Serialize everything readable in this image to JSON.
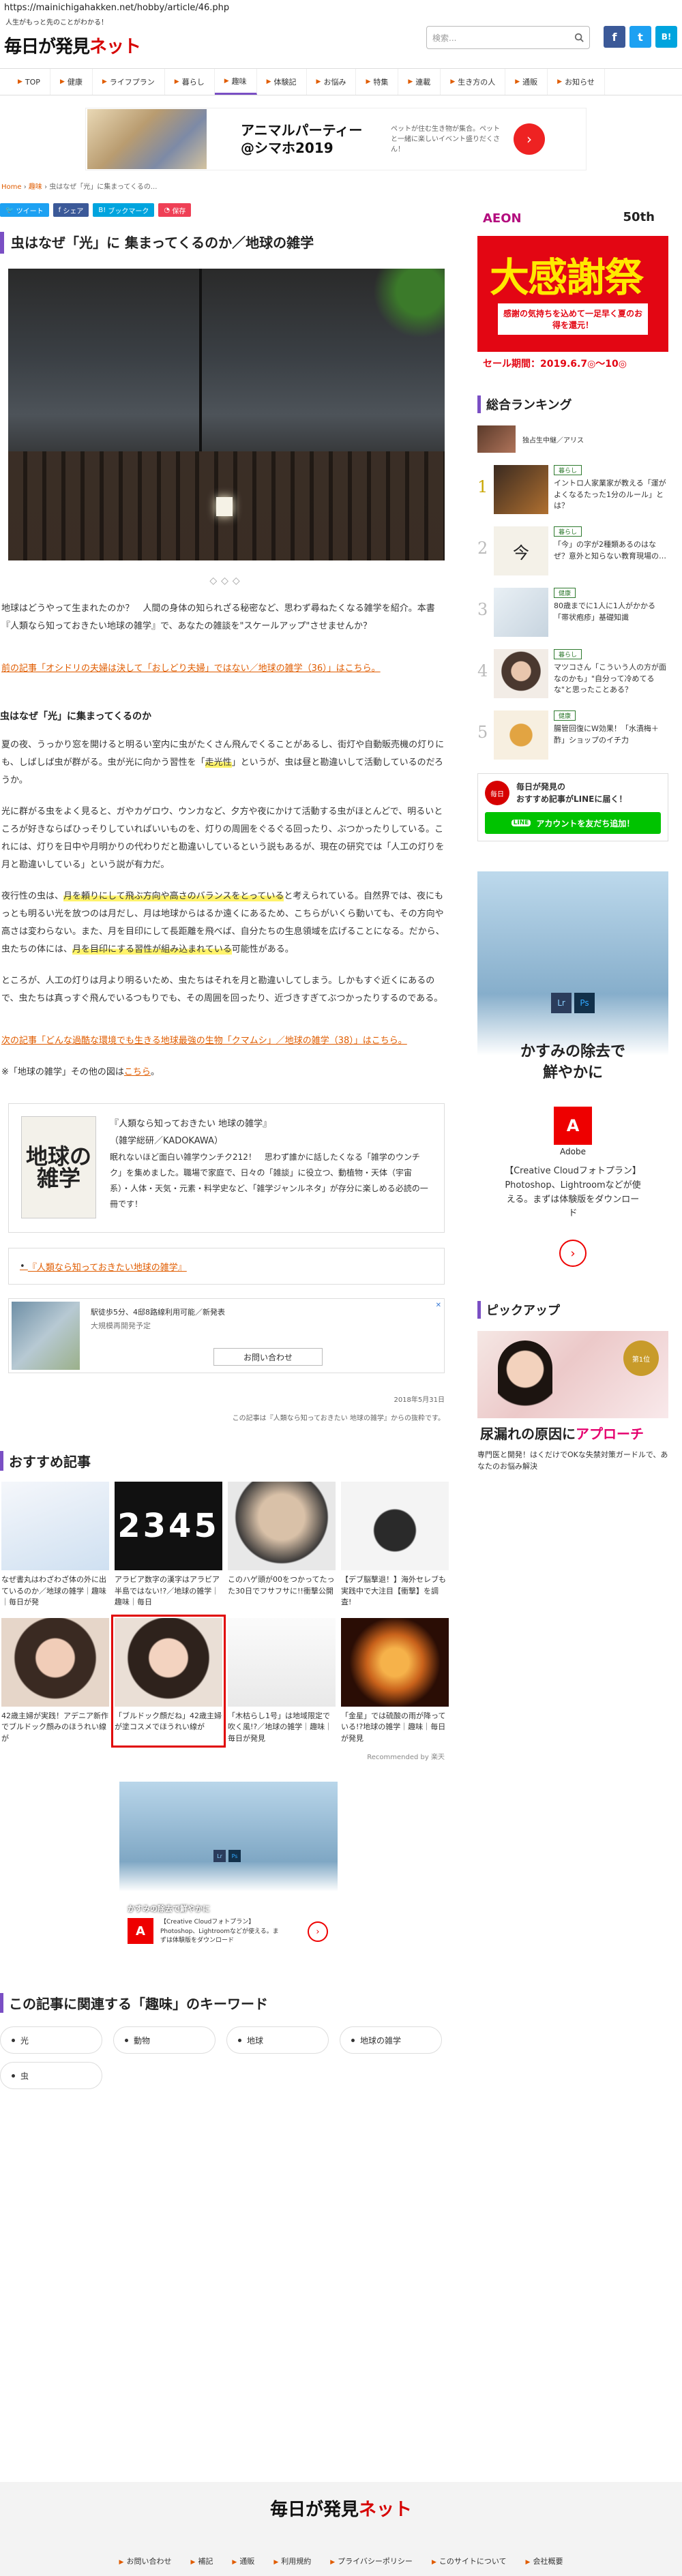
{
  "browser": {
    "url": "https://mainichigahakken.net/hobby/article/46.php"
  },
  "header": {
    "tagline": "人生がもっと先のことがわかる！",
    "logo_main": "毎日が発見",
    "logo_net": "ネット",
    "search_placeholder": "検索..."
  },
  "social": {
    "facebook": "f",
    "twitter": "t",
    "hatena": "B!"
  },
  "nav": {
    "items": [
      "TOP",
      "健康",
      "ライフプラン",
      "暮らし",
      "趣味",
      "体験記",
      "お悩み",
      "特集",
      "連載",
      "生き方の人",
      "通販",
      "お知らせ"
    ]
  },
  "top_ad": {
    "title": "アニマルパーティー\n@シマホ2019",
    "desc": "ペットが住む生き物が集合。ペットと一緒に楽しいイベント盛りだくさん！",
    "go": "›"
  },
  "breadcrumb": {
    "home": "Home",
    "sep1": "›",
    "cat": "趣味",
    "sep2": "›",
    "current": "虫はなぜ「光」に集まってくるの..."
  },
  "share": {
    "tweet": "ツイート",
    "facebook": "シェア",
    "hatena": "ブックマーク",
    "pocket": "保存"
  },
  "article": {
    "title": "虫はなぜ「光」に 集まってくるのか／地球の雑学",
    "divider": "◇◇◇",
    "intro": "地球はどうやって生まれたのか？　人間の身体の知られざる秘密など、思わず尋ねたくなる雑学を紹介。本書『人類なら知っておきたい地球の雑学』で、あなたの雑談を\"スケールアップ\"させませんか？",
    "prev_link": "前の記事「オシドリの夫婦は決して「おしどり夫婦」ではない／地球の雑学（36）」はこちら。",
    "subheading": "虫はなぜ「光」に集まってくるのか",
    "p1_before": "夏の夜、うっかり窓を開けると明るい室内に虫がたくさん飛んでくることがあるし、街灯や自動販売機の灯りにも、しばしば虫が群がる。虫が光に向かう習性を「",
    "p1_highlight": "走光性",
    "p1_after": "」というが、虫は昼と勘違いして活動しているのだろうか。",
    "p2": "光に群がる虫をよく見ると、ガやカゲロウ、ウンカなど、夕方や夜にかけて活動する虫がほとんどで、明るいところが好きならばひっそりしていればいいものを、灯りの周囲をぐるぐる回ったり、ぶつかったりしている。これには、灯りを日中や月明かりの代わりだと勘違いしているという説もあるが、現在の研究では「人工の灯りを月と勘違いしている」という説が有力だ。",
    "p3_a": "夜行性の虫は、",
    "p3_h1": "月を頼りにして飛ぶ方向や高さのバランスをとっている",
    "p3_b": "と考えられている。自然界では、夜にもっとも明るい光を放つのは月だし、月は地球からはるか遠くにあるため、こちらがいくら動いても、その方向や高さは変わらない。また、月を目印にして長距離を飛べば、自分たちの生息領域を広げることになる。だから、虫たちの体には、",
    "p3_h2": "月を目印にする習性が組み込まれている",
    "p3_c": "可能性がある。",
    "p4": "ところが、人工の灯りは月より明るいため、虫たちはそれを月と勘違いしてしまう。しかもすぐ近くにあるので、虫たちは真っすぐ飛んでいるつもりでも、その周囲を回ったり、近づきすぎてぶつかったりするのである。",
    "next_link": "次の記事「どんな過酷な環境でも生きる地球最強の生物「クマムシ」／地球の雑学（38）」はこちら。",
    "series_note_before": "※「地球の雑学」その他の図は",
    "series_note_link": "こちら",
    "series_note_after": "。",
    "date": "2018年5月31日",
    "credit": "この記事は『人類なら知っておきたい 地球の雑学』からの抜粋です。"
  },
  "book": {
    "cover": "地球の雑学",
    "title": "『人類なら知っておきたい 地球の雑学』",
    "publisher": "（雑学総研／KADOKAWA）",
    "desc": "眠れないほど面白い雑学ウンチク212！　思わず誰かに話したくなる「雑学のウンチク」を集めました。職場で家庭で、日々の「雑談」に役立つ、動植物・天体（宇宙系）・人体・天気・元素・料学史など、「雑学ジャンルネタ」が存分に楽しめる必読の一冊です！",
    "link": "『人類なら知っておきたい地球の雑学』"
  },
  "ad_box": {
    "line1": "駅徒歩5分、4邸8路線利用可能／新発表",
    "line2": "大規模再開発予定",
    "cta": "お問い合わせ",
    "close": "✕"
  },
  "reco": {
    "heading": "おすすめ記事",
    "items": [
      {
        "cap": "なぜ書丸はわざわざ体の外に出ているのか／地球の雑学｜趣味｜毎日が発"
      },
      {
        "cap": "アラビア数字の漢字はアラビア半島ではない!?／地球の雑学｜趣味｜毎日"
      },
      {
        "cap": "このハゲ頭が00をつかってたった30日でフサフサに!!衝撃公開"
      },
      {
        "cap": "【デブ脳撃退！】海外セレブも実践中で大注目【衝撃】を調査!"
      },
      {
        "cap": "42歳主婦が実践！アデニア新作でブルドック顔みのほうれい線が"
      },
      {
        "cap": "「ブルドック顔だね」42歳主婦が塗コスメでほうれい線が"
      },
      {
        "cap": "「木枯らし1号」は地域限定で吹く風!?／地球の雑学｜趣味｜毎日が発見"
      },
      {
        "cap": "「金星」では硫酸の雨が降っている!?地球の雑学｜趣味｜毎日が発見"
      }
    ],
    "recommended_by": "Recommended by 楽天"
  },
  "bottom_ad": {
    "caption": "かすみの除去で鮮やかに",
    "adobe": "A",
    "text": "【Creative Cloudフォトプラン】Photoshop、Lightroomなどが使える。まずは体験版をダウンロード",
    "go": "›",
    "lr": "Lr",
    "ps": "Ps"
  },
  "keywords": {
    "heading": "この記事に関連する「趣味」のキーワード",
    "items": [
      "光",
      "動物",
      "地球",
      "地球の雑学",
      "虫"
    ]
  },
  "sidebar": {
    "aeon": {
      "brand": "AEON",
      "fifty": "50th",
      "big": "大感謝祭",
      "sub": "感謝の気持ちを込めて一足早く夏のお得を還元！",
      "date": "セール期間：2019.6.7◎～10◎"
    },
    "ranking_heading": "総合ランキング",
    "ranking_top": "独占生中継／アリス",
    "ranking": [
      {
        "num": "1",
        "cat": "暮らし",
        "title": "イントロ人家業家が教える「運がよくなるたった1分のルール」とは？"
      },
      {
        "num": "2",
        "cat": "暮らし",
        "title": "「今」の字が2種類あるのはなぜ？意外と知らない教育現場の…"
      },
      {
        "num": "3",
        "cat": "健康",
        "title": "80歳までに1人に1人がかかる「帯状疱疹」基礎知識"
      },
      {
        "num": "4",
        "cat": "暮らし",
        "title": "マツコさん「こういう人の方が面なのかも」\"自分って冷めてるな\"と思ったことある？"
      },
      {
        "num": "5",
        "cat": "健康",
        "title": "腸管回復にW効果！「水漬梅＋酢」ショップのイチ力"
      }
    ],
    "line_title": "毎日が発見の\nおすすめ記事がLINEに届く！",
    "line_button": "アカウントを友だち追加！",
    "side_ad": {
      "lr": "Lr",
      "ps": "Ps",
      "heading": "かすみの除去で\n鮮やかに",
      "adobe": "A",
      "adobe_label": "Adobe",
      "desc": "【Creative Cloudフォトプラン】Photoshop、Lightroomなどが使える。まずは体験版をダウンロード",
      "go": "›"
    },
    "pickup_heading": "ピックアップ",
    "pickup_badge": "第1位",
    "pickup_title_a": "尿漏れの原因に",
    "pickup_title_b": "アプローチ",
    "pickup_caption": "専門医と開発！はくだけでOKな失禁対策ガードルで、あなたのお悩み解決"
  },
  "footer": {
    "logo_main": "毎日が発見",
    "logo_net": "ネット",
    "links": [
      "お問い合わせ",
      "補記",
      "通販",
      "利用規約",
      "プライバシーポリシー",
      "このサイトについて",
      "会社概要"
    ]
  },
  "colors": {
    "accent": "#7a4fc4",
    "link": "#e05c00",
    "highlight": "#fff36b",
    "line": "#00c300",
    "brand_red": "#d60000"
  }
}
